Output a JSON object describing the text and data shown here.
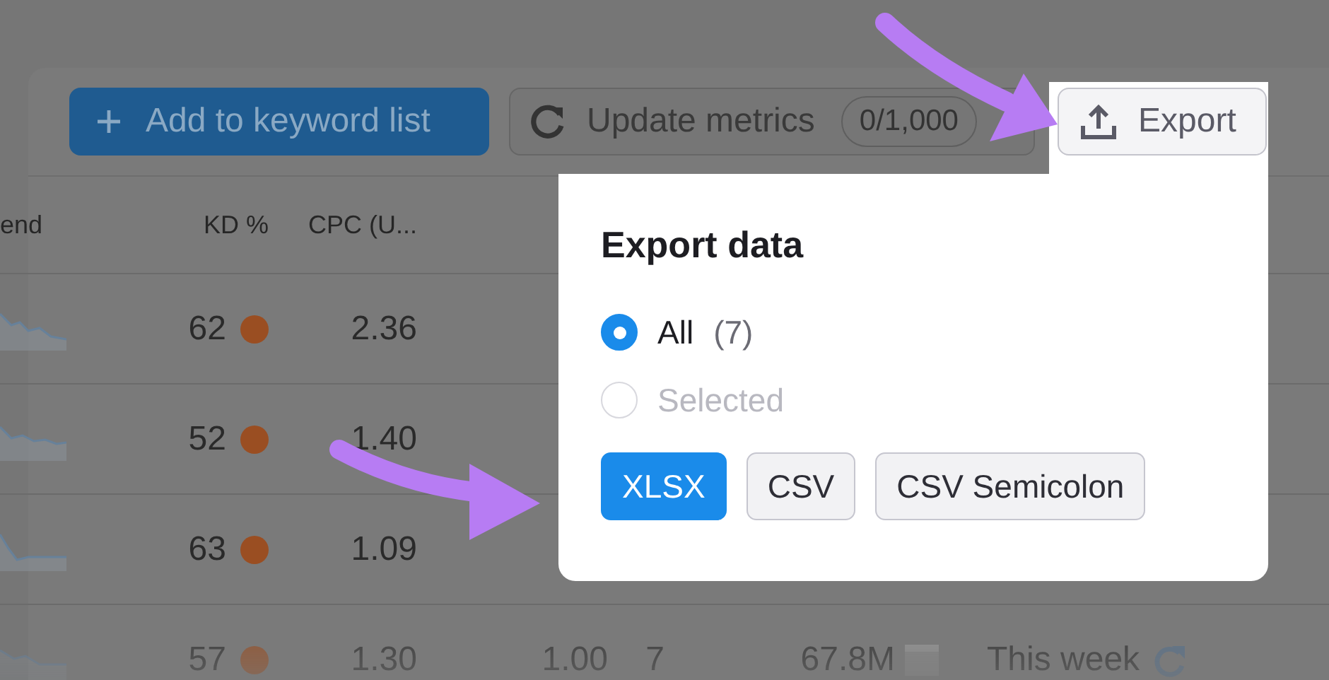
{
  "toolbar": {
    "add_button": {
      "label": "Add to keyword list"
    },
    "update_button": {
      "label": "Update metrics",
      "counter": "0/1,000"
    },
    "export_button": {
      "label": "Export"
    }
  },
  "table": {
    "columns": [
      "end",
      "KD %",
      "CPC (U..."
    ],
    "rows": [
      {
        "kd": "62",
        "cpc": "2.36",
        "faded": false
      },
      {
        "kd": "52",
        "cpc": "1.40",
        "faded": false
      },
      {
        "kd": "63",
        "cpc": "1.09",
        "faded": false
      },
      {
        "kd": "57",
        "cpc": "1.30",
        "column_4": "1.00",
        "column_5": "7",
        "column_6": "67.8M",
        "column_7": "This week",
        "faded": true
      }
    ]
  },
  "export_menu": {
    "title": "Export data",
    "options": [
      {
        "label": "All",
        "count": "(7)",
        "selected": true,
        "disabled": false
      },
      {
        "label": "Selected",
        "selected": false,
        "disabled": true
      }
    ],
    "formats": [
      {
        "label": "XLSX",
        "selected": true
      },
      {
        "label": "CSV",
        "selected": false
      },
      {
        "label": "CSV Semicolon",
        "selected": false
      }
    ]
  }
}
